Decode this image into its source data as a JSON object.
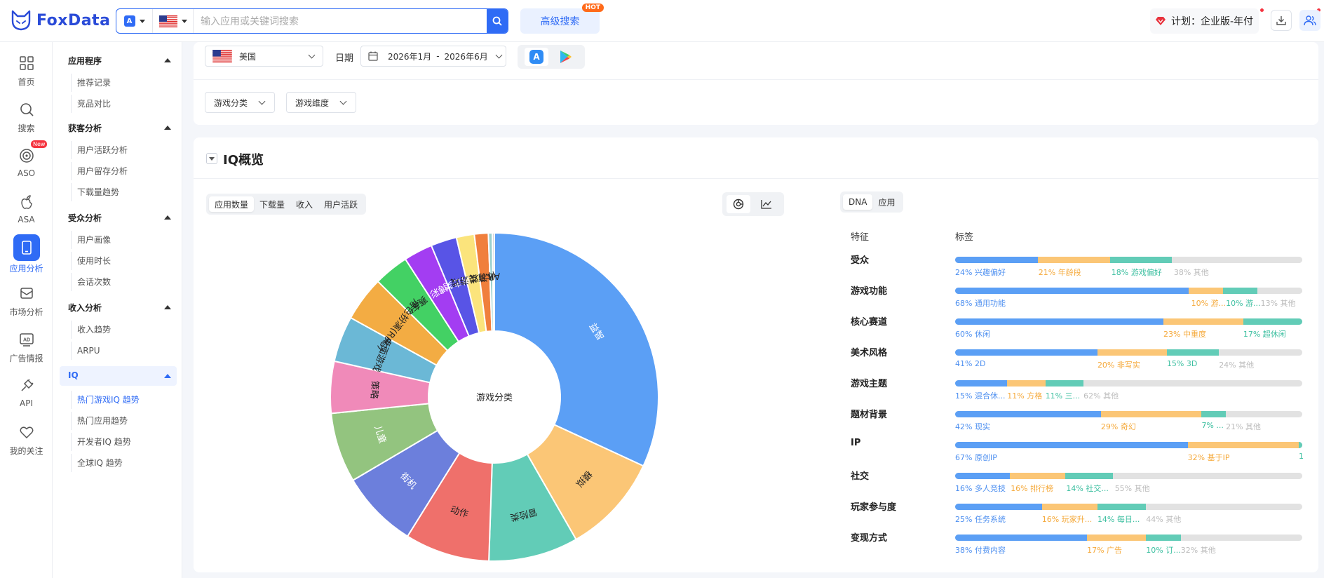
{
  "header": {
    "logo_text": "FoxData",
    "search_placeholder": "输入应用或关键词搜索",
    "advanced_search": "高级搜索",
    "hot_badge": "HOT",
    "plan_label": "计划：企业版-年付"
  },
  "rail": [
    {
      "label": "首页",
      "icon": "grid-icon"
    },
    {
      "label": "搜索",
      "icon": "search-icon"
    },
    {
      "label": "ASO",
      "icon": "target-icon",
      "badge": "New"
    },
    {
      "label": "ASA",
      "icon": "apple-icon"
    },
    {
      "label": "应用分析",
      "icon": "phone-icon",
      "active": true
    },
    {
      "label": "市场分析",
      "icon": "inbox-icon"
    },
    {
      "label": "广告情报",
      "icon": "ad-icon"
    },
    {
      "label": "API",
      "icon": "plug-icon"
    },
    {
      "label": "我的关注",
      "icon": "heart-icon"
    }
  ],
  "sidebar": {
    "sections": [
      {
        "title": "应用程序",
        "items": [
          "推荐记录",
          "竞品对比"
        ]
      },
      {
        "title": "获客分析",
        "items": [
          "用户活跃分析",
          "用户留存分析",
          "下载量趋势"
        ]
      },
      {
        "title": "受众分析",
        "items": [
          "用户画像",
          "使用时长",
          "会话次数"
        ]
      },
      {
        "title": "收入分析",
        "items": [
          "收入趋势",
          "ARPU"
        ]
      },
      {
        "title": "IQ",
        "items": [
          "热门游戏IQ 趋势",
          "热门应用趋势",
          "开发者IQ 趋势",
          "全球IQ 趋势"
        ]
      }
    ]
  },
  "filters": {
    "country": "美国",
    "date_label": "日期",
    "date_start": "2026年1月",
    "date_sep": "-",
    "date_end": "2026年6月",
    "game_category": "游戏分类",
    "game_dimension": "游戏维度"
  },
  "overview": {
    "title": "IQ概览",
    "metric_tabs": [
      "应用数量",
      "下载量",
      "收入",
      "用户活跃"
    ],
    "dna_tabs": [
      "DNA",
      "应用"
    ],
    "col_feature": "特征",
    "col_tag": "标签"
  },
  "chart_data": {
    "type": "pie",
    "center_label": "游戏分类",
    "slices": [
      {
        "label": "益智",
        "value": 32.5,
        "color": "#5b9ff5"
      },
      {
        "label": "模拟",
        "value": 10.0,
        "color": "#fbc676"
      },
      {
        "label": "冒险类",
        "value": 9.0,
        "color": "#62ccb7"
      },
      {
        "label": "动作",
        "value": 8.5,
        "color": "#ef706b"
      },
      {
        "label": "街机",
        "value": 7.8,
        "color": "#6c7fdc"
      },
      {
        "label": "儿童",
        "value": 7.0,
        "color": "#93c47f"
      },
      {
        "label": "策略",
        "value": 5.2,
        "color": "#f08ab9"
      },
      {
        "label": "桌面游戏",
        "value": 4.6,
        "color": "#6bb8d6"
      },
      {
        "label": "角色扮演(RPG)",
        "value": 4.5,
        "color": "#f3ac43"
      },
      {
        "label": "赛车",
        "value": 3.5,
        "color": "#43d164"
      },
      {
        "label": "博彩",
        "value": 2.9,
        "color": "#a33df2"
      },
      {
        "label": "射击类",
        "value": 2.6,
        "color": "#5854e6"
      },
      {
        "label": "体育类游戏",
        "value": 1.8,
        "color": "#fbe47c"
      },
      {
        "label": "AR游戏",
        "value": 1.4,
        "color": "#f07f3c"
      },
      {
        "label": "",
        "value": 0.4,
        "color": "#9ad0ce"
      },
      {
        "label": "",
        "value": 0.2,
        "color": "#cccccc"
      }
    ]
  },
  "dna": [
    {
      "feature": "受众",
      "segments": [
        {
          "pct": 24,
          "text": "24% 兴趣偏好"
        },
        {
          "pct": 21,
          "text": "21% 年龄段"
        },
        {
          "pct": 18,
          "text": "18% 游戏偏好"
        },
        {
          "pct": 38,
          "text": "38% 其他"
        }
      ]
    },
    {
      "feature": "游戏功能",
      "segments": [
        {
          "pct": 68,
          "text": "68% 通用功能"
        },
        {
          "pct": 10,
          "text": "10% 游..."
        },
        {
          "pct": 10,
          "text": "10% 游..."
        },
        {
          "pct": 13,
          "text": "13% 其他"
        }
      ]
    },
    {
      "feature": "核心赛道",
      "segments": [
        {
          "pct": 60,
          "text": "60% 休闲"
        },
        {
          "pct": 23,
          "text": "23% 中重度"
        },
        {
          "pct": 17,
          "text": "17% 超休闲"
        },
        {
          "pct": 0,
          "text": ""
        }
      ]
    },
    {
      "feature": "美术风格",
      "segments": [
        {
          "pct": 41,
          "text": "41% 2D"
        },
        {
          "pct": 20,
          "text": "20% 非写实"
        },
        {
          "pct": 15,
          "text": "15% 3D"
        },
        {
          "pct": 24,
          "text": "24% 其他"
        }
      ]
    },
    {
      "feature": "游戏主题",
      "segments": [
        {
          "pct": 15,
          "text": "15% 混合休..."
        },
        {
          "pct": 11,
          "text": "11% 方格"
        },
        {
          "pct": 11,
          "text": "11% 三..."
        },
        {
          "pct": 62,
          "text": "62% 其他"
        }
      ]
    },
    {
      "feature": "题材背景",
      "segments": [
        {
          "pct": 42,
          "text": "42% 现实"
        },
        {
          "pct": 29,
          "text": "29% 奇幻"
        },
        {
          "pct": 7,
          "text": "7% ..."
        },
        {
          "pct": 21,
          "text": "21% 其他"
        }
      ]
    },
    {
      "feature": "IP",
      "segments": [
        {
          "pct": 67,
          "text": "67% 原创IP"
        },
        {
          "pct": 32,
          "text": "32% 基于IP"
        },
        {
          "pct": 1,
          "text": "1"
        },
        {
          "pct": 0,
          "text": ""
        }
      ]
    },
    {
      "feature": "社交",
      "segments": [
        {
          "pct": 16,
          "text": "16% 多人竞技"
        },
        {
          "pct": 16,
          "text": "16% 排行榜"
        },
        {
          "pct": 14,
          "text": "14% 社交..."
        },
        {
          "pct": 55,
          "text": "55% 其他"
        }
      ]
    },
    {
      "feature": "玩家参与度",
      "segments": [
        {
          "pct": 25,
          "text": "25% 任务系统"
        },
        {
          "pct": 16,
          "text": "16% 玩家升..."
        },
        {
          "pct": 14,
          "text": "14% 每日..."
        },
        {
          "pct": 44,
          "text": "44% 其他"
        }
      ]
    },
    {
      "feature": "变现方式",
      "segments": [
        {
          "pct": 38,
          "text": "38% 付费内容"
        },
        {
          "pct": 17,
          "text": "17% 广告"
        },
        {
          "pct": 10,
          "text": "10% 订..."
        },
        {
          "pct": 32,
          "text": "32% 其他"
        }
      ]
    }
  ],
  "colors": {
    "accent": "#2f6bf5",
    "seg1": "#5b9ff5",
    "seg2": "#fbc676",
    "seg3": "#62ccb7",
    "seg4": "#e2e2e2"
  }
}
